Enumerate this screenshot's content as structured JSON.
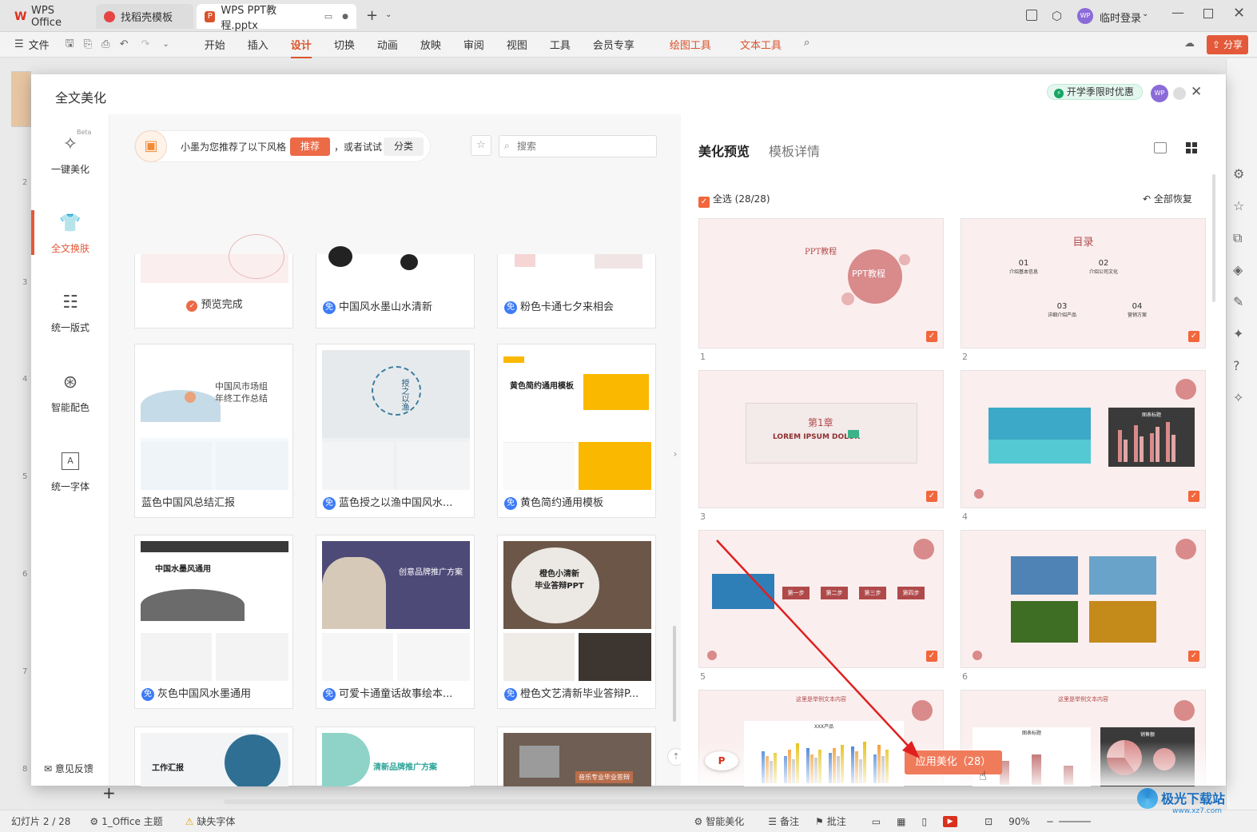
{
  "tabs": [
    {
      "label": "WPS Office"
    },
    {
      "label": "找稻壳模板"
    },
    {
      "label": "WPS PPT教程.pptx"
    }
  ],
  "titlebar": {
    "user": "临时登录",
    "avatar": "WP"
  },
  "menu": {
    "file": "文件",
    "items": [
      "开始",
      "插入",
      "设计",
      "切换",
      "动画",
      "放映",
      "审阅",
      "视图",
      "工具",
      "会员专享",
      "绘图工具",
      "文本工具"
    ],
    "share": "分享"
  },
  "dialog": {
    "title": "全文美化",
    "promo": "开学季限时优惠",
    "avatar": "WP"
  },
  "leftnav": [
    {
      "label": "一键美化",
      "beta": "Beta",
      "icon": "magic-wand-icon"
    },
    {
      "label": "全文换肤",
      "icon": "shirt-icon"
    },
    {
      "label": "统一版式",
      "icon": "layout-icon"
    },
    {
      "label": "智能配色",
      "icon": "palette-icon"
    },
    {
      "label": "统一字体",
      "icon": "font-icon"
    }
  ],
  "feedback": "意见反馈",
  "recommend": {
    "text": "小墨为您推荐了以下风格",
    "btn_recommend": "推荐",
    "or_try": "，或者试试",
    "btn_category": "分类",
    "search_placeholder": "搜索"
  },
  "templates_top": [
    {
      "label": "预览完成",
      "free": false,
      "done": true
    },
    {
      "label": "中国风水墨山水清新",
      "free": true
    },
    {
      "label": "粉色卡通七夕来相会",
      "free": true
    }
  ],
  "templates": [
    {
      "label": "蓝色中国风总结汇报",
      "free": false,
      "title": "中国风市场组\n年终工作总结"
    },
    {
      "label": "蓝色授之以渔中国风水...",
      "free": true,
      "title": "授之以渔"
    },
    {
      "label": "黄色简约通用模板",
      "free": true,
      "title": "黄色简约通用模板"
    },
    {
      "label": "灰色中国风水墨通用",
      "free": true,
      "title": "中国水墨风通用"
    },
    {
      "label": "可爱卡通童话故事绘本...",
      "free": true,
      "title": "创意品牌推广方案"
    },
    {
      "label": "橙色文艺清新毕业答辩P...",
      "free": true,
      "title": "橙色小清新\n毕业答辩PPT"
    },
    {
      "label": "",
      "free": false,
      "title": "工作汇报"
    },
    {
      "label": "",
      "free": false,
      "title": "清新品牌推广方案"
    },
    {
      "label": "",
      "free": false,
      "title": "音乐专业毕业答辩"
    }
  ],
  "free_badge": "免",
  "preview": {
    "tab_active": "美化预览",
    "tab_other": "模板详情",
    "select_all": "全选 (28/28)",
    "restore": "全部恢复",
    "apply": "应用美化（28）"
  },
  "slides": [
    {
      "num": "1",
      "title": "PPT教程",
      "subtitle": "PPT教程"
    },
    {
      "num": "2",
      "title": "目录",
      "items": [
        {
          "n": "01",
          "t": "介绍基本信息"
        },
        {
          "n": "02",
          "t": "介绍公司文化"
        },
        {
          "n": "03",
          "t": "详细介绍产品"
        },
        {
          "n": "04",
          "t": "营销方案"
        }
      ]
    },
    {
      "num": "3",
      "title": "第1章",
      "subtitle": "LOREM IPSUM DOLOR"
    },
    {
      "num": "4",
      "title": "图表标题"
    },
    {
      "num": "5",
      "steps": [
        "第一步",
        "第二步",
        "第三步",
        "第四步"
      ]
    },
    {
      "num": "6"
    },
    {
      "num": "",
      "title": "这里是举例文本内容",
      "chart_title": "XXX产品"
    },
    {
      "num": "",
      "title": "这里是举例文本内容",
      "chart_title": "图表标题",
      "pie_title": "销售额"
    }
  ],
  "status": {
    "slide": "幻灯片 2 / 28",
    "theme": "1_Office 主题",
    "font": "缺失字体",
    "beautify": "智能美化",
    "notes": "备注",
    "comment": "批注",
    "zoom": "90%"
  },
  "watermark": "极光下载站",
  "watermark_url": "www.xz7.com",
  "colors": {
    "accent": "#e3593a",
    "wps_red": "#d9532c",
    "free_blue": "#3d7bf6"
  }
}
